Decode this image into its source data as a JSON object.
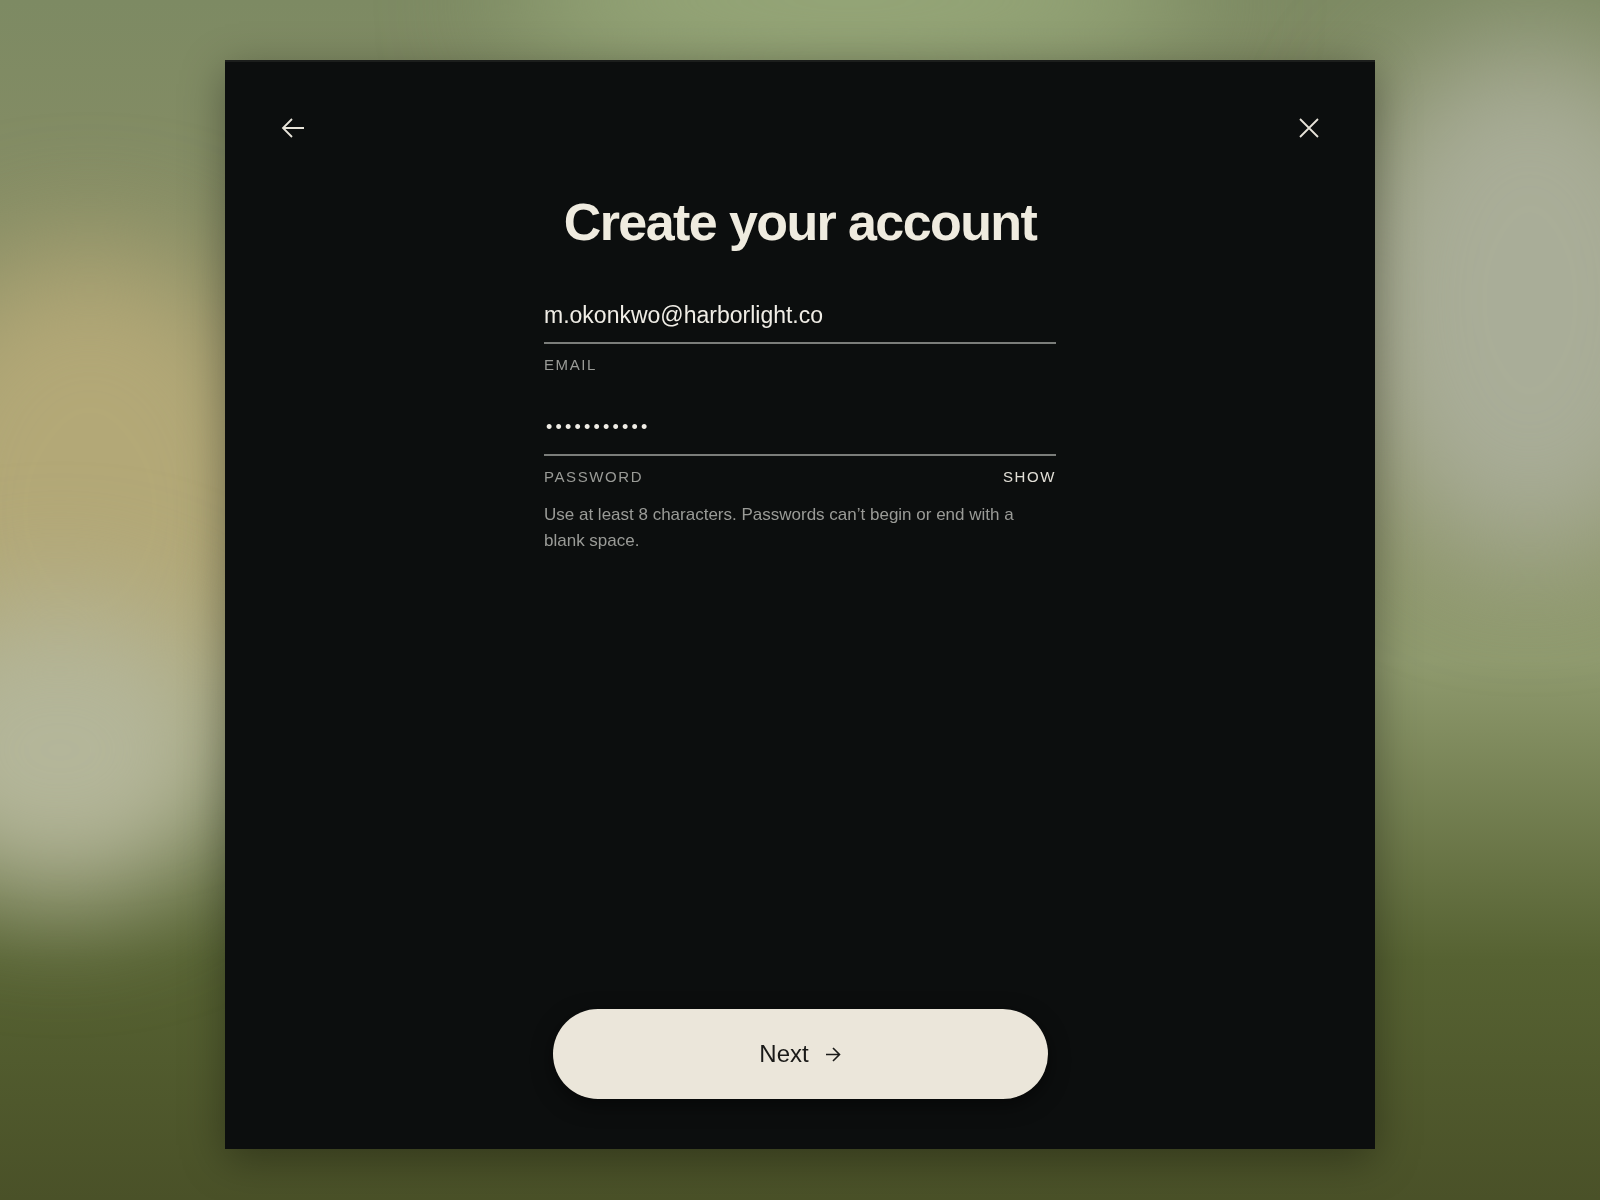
{
  "title": "Create your account",
  "fields": [
    {
      "kind": "email",
      "label": "EMAIL",
      "value": "m.okonkwo@harborlight.co"
    },
    {
      "kind": "password",
      "label": "PASSWORD",
      "value": "•••••••••••",
      "toggle": "SHOW"
    }
  ],
  "hint": "Use at least 8 characters. Passwords can’t begin or end with a blank space.",
  "primary_button": {
    "label": "Next"
  }
}
